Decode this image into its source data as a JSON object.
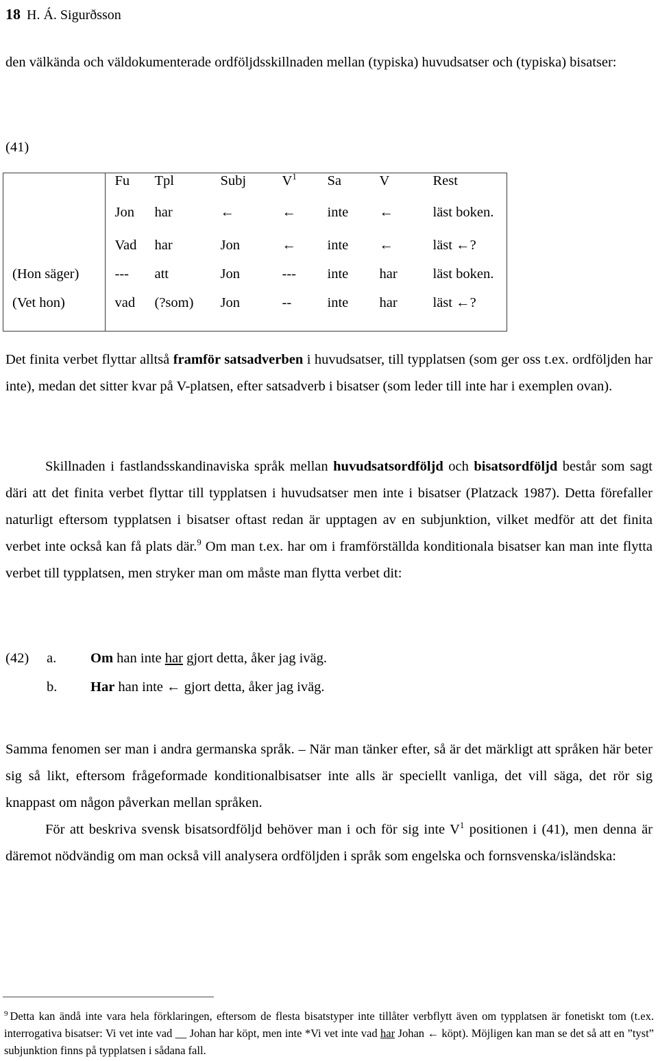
{
  "header": {
    "page_number": "18",
    "author": "H. Á. Sigurðsson"
  },
  "paragraphs": {
    "p1_line": "den välkända och väldokumenterade ordföljdsskillnaden mellan (typiska) huvudsatser och (typiska) bisatser:",
    "p2_a": "Det finita verbet flyttar alltså ",
    "p2_b_bold": "framför satsadverben",
    "p2_c": " i huvudsatser, till typplatsen (som ger oss t.ex. ordföljden har inte), medan det sitter kvar på V-platsen, efter satsadverb i bisatser (som leder till inte har i exemplen ovan).",
    "p3_a": "Skillnaden i fastlandsskandinaviska språk mellan ",
    "p3_b_bold": "huvudsatsordföljd",
    "p3_c": " och ",
    "p3_d_bold": "bisatsordföljd",
    "p3_e": " består som sagt däri att det finita verbet flyttar till typplatsen i huvudsatser men inte i bisatser (Platzack 1987). Detta förefaller naturligt eftersom typplatsen i bisatser oftast redan är upptagen av en subjunktion, vilket medför att det finita verbet inte också kan få plats där.",
    "p3_footnote_ref": "9",
    "p3_f": " Om man t.ex. har om i framförställda konditionala bisatser kan man inte flytta verbet till typplatsen, men stryker man om måste man flytta verbet dit:",
    "p4": "Samma fenomen ser man i andra germanska språk. – När man tänker efter, så är det märkligt att språken här beter sig så likt, eftersom frågeformade konditionalbisatser inte alls är speciellt vanliga, det vill säga, det rör sig knappast om någon påverkan mellan språken.",
    "p5_a": "För att beskriva svensk bisatsordföljd behöver man i och för sig inte V",
    "p5_sup": "1",
    "p5_b": " positionen i (41), men denna är däremot nödvändig om man också vill analysera ordföljden i språk som engelska och fornsvenska/isländska:"
  },
  "example_41": {
    "number": "(41)",
    "columns": [
      "",
      "Fu",
      "Tpl",
      "Subj",
      "V1",
      "Sa",
      "V",
      "Rest"
    ],
    "header": {
      "context": "",
      "fu": "Fu",
      "tpl": "Tpl",
      "subj": "Subj",
      "v1": "V",
      "v1_sup": "1",
      "sa": "Sa",
      "v": "V",
      "rest": "Rest"
    },
    "rows": [
      {
        "context": "",
        "fu": "Jon",
        "tpl": "har",
        "tpl_bold": true,
        "subj": "←",
        "v1": "←",
        "sa": "inte",
        "v": "←",
        "v_bold": false,
        "rest": "läst boken."
      },
      {
        "context": "",
        "fu": "Vad",
        "tpl": "har",
        "tpl_bold": true,
        "subj": "Jon",
        "v1": "←",
        "sa": "inte",
        "v": "←",
        "v_bold": false,
        "rest": "läst ←?"
      },
      {
        "context": "(Hon säger)",
        "fu": "---",
        "tpl": "att",
        "tpl_bold": false,
        "subj": "Jon",
        "v1": "---",
        "sa": "inte",
        "v": "har",
        "v_bold": true,
        "rest": "läst boken."
      },
      {
        "context": "(Vet hon)",
        "fu": "vad",
        "tpl": "(?som)",
        "tpl_bold": false,
        "subj": "Jon",
        "v1": "--",
        "sa": "inte",
        "v": "har",
        "v_bold": true,
        "rest": "läst ←?"
      }
    ]
  },
  "example_42": {
    "number": "(42)",
    "items": [
      {
        "letter": "a.",
        "prefix_bold": "Om",
        "mid": " han inte ",
        "underlined": "har",
        "suffix": " gjort detta, åker jag iväg."
      },
      {
        "letter": "b.",
        "prefix_bold": "Har",
        "mid": " han inte ← ",
        "underlined": "",
        "suffix": " gjort detta, åker jag iväg."
      }
    ]
  },
  "footnote": {
    "mark": "9",
    "a": "Detta kan ändå inte vara hela förklaringen, eftersom de flesta bisatstyper inte tillåter verbflytt även om typplatsen är fonetiskt tom (t.ex. interrogativa bisatser: Vi vet inte vad __ Johan har köpt, men inte *Vi vet inte vad ",
    "b_underlined": "har",
    "c": " Johan ← köpt). Möjligen kan man se det så att en ”tyst” subjunktion finns på typplatsen i sådana fall."
  }
}
